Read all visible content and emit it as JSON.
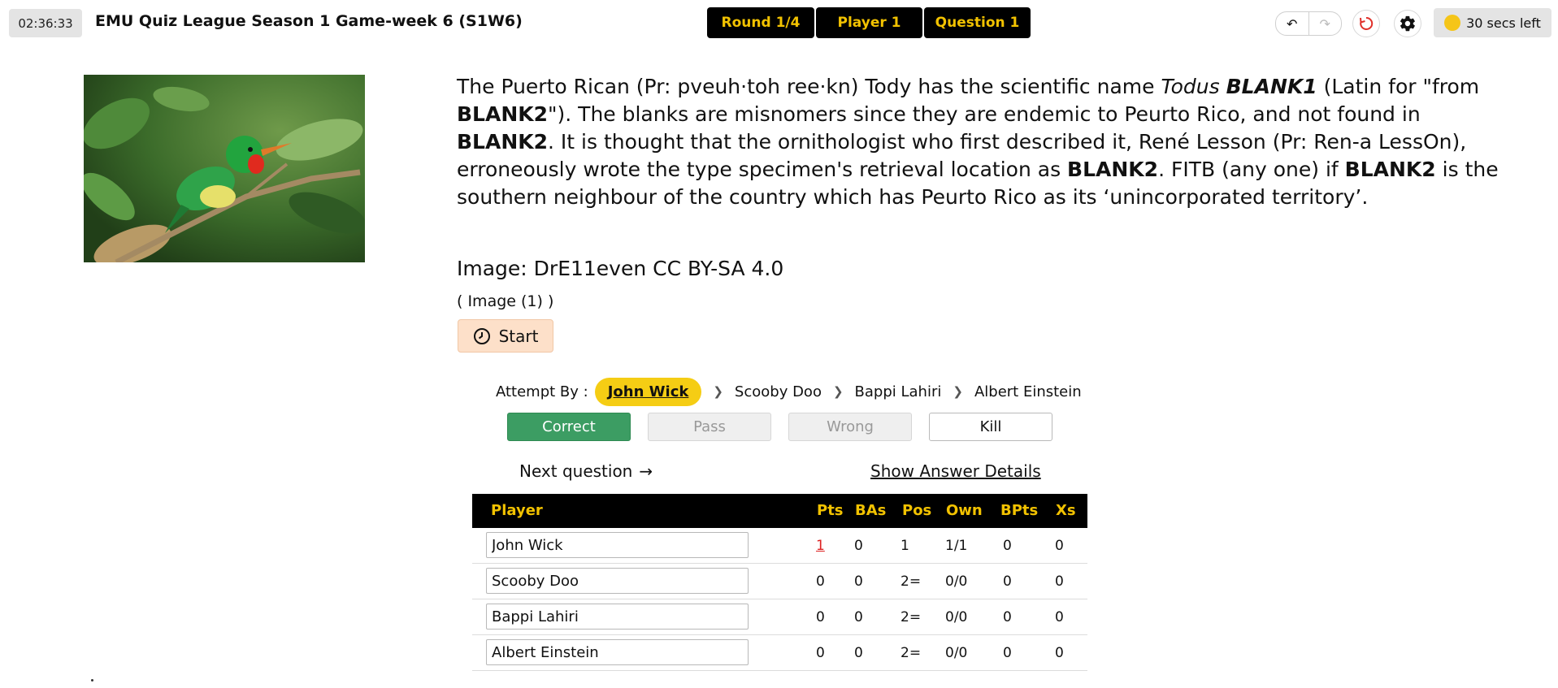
{
  "header": {
    "clock": "02:36:33",
    "title": "EMU Quiz League Season 1 Game-week 6 (S1W6)",
    "nav": [
      "Round 1/4",
      "Player 1",
      "Question 1"
    ],
    "timer": "30 secs left"
  },
  "question": {
    "p1": "The Puerto Rican (Pr: pveuh·toh ree·kn) Tody has the scientific name ",
    "italic": "Todus ",
    "blank1": "BLANK1",
    "p2": " (Latin for \"from ",
    "blank2": "BLANK2",
    "p3": "\"). The blanks are misnomers since they are endemic to Peurto Rico, and not found in ",
    "p4": ". It is thought that the ornithologist who first described it, René Lesson (Pr: Ren-a LessOn), erroneously wrote the type specimen's retrieval location as ",
    "p5": ". FITB (any one) if ",
    "p6": " is the southern neighbour of the country which has Peurto Rico as its ‘unincorporated territory’.",
    "credit": "Image: DrE11even CC BY-SA 4.0",
    "image_ref": "( Image (1) )",
    "start_label": "Start"
  },
  "attempt": {
    "label": "Attempt By :",
    "players": [
      "John Wick",
      "Scooby Doo",
      "Bappi Lahiri",
      "Albert Einstein"
    ]
  },
  "actions": {
    "correct": "Correct",
    "pass": "Pass",
    "wrong": "Wrong",
    "kill": "Kill",
    "next": "Next question",
    "show_answer": "Show Answer Details"
  },
  "table": {
    "headers": [
      "Player",
      "Pts",
      "BAs",
      "Pos",
      "Own",
      "BPts",
      "Xs"
    ],
    "rows": [
      {
        "player": "John Wick",
        "pts": "1",
        "bas": "0",
        "pos": "1",
        "own": "1/1",
        "bpts": "0",
        "xs": "0"
      },
      {
        "player": "Scooby Doo",
        "pts": "0",
        "bas": "0",
        "pos": "2=",
        "own": "0/0",
        "bpts": "0",
        "xs": "0"
      },
      {
        "player": "Bappi Lahiri",
        "pts": "0",
        "bas": "0",
        "pos": "2=",
        "own": "0/0",
        "bpts": "0",
        "xs": "0"
      },
      {
        "player": "Albert Einstein",
        "pts": "0",
        "bas": "0",
        "pos": "2=",
        "own": "0/0",
        "bpts": "0",
        "xs": "0"
      }
    ]
  },
  "colors": {
    "nav_bg": "#000000",
    "nav_text": "#f2c200",
    "correct_bg": "#3c9d63",
    "active_player": "#f5cd14",
    "timer_dot": "#f5c518"
  }
}
